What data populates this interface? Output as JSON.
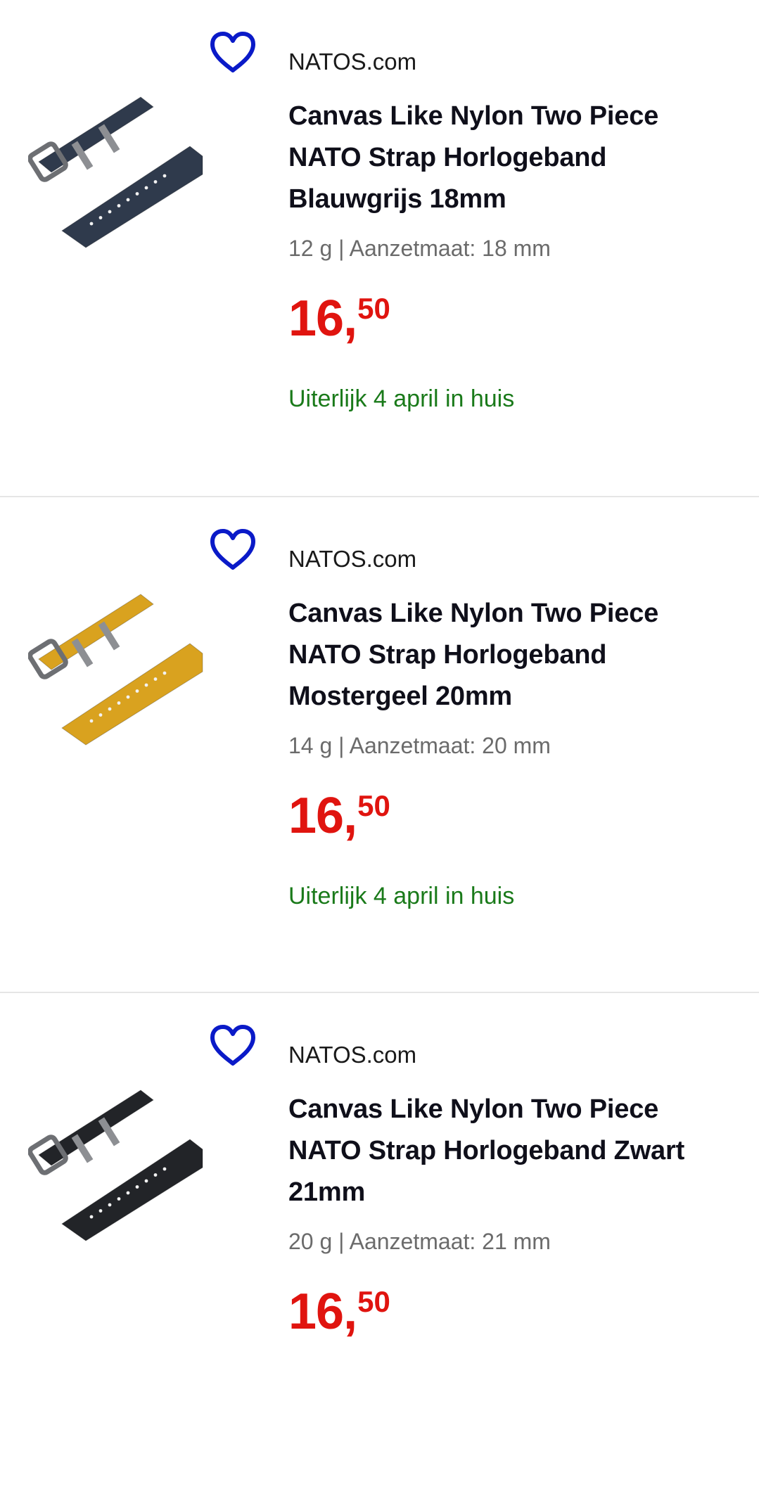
{
  "products": [
    {
      "seller": "NATOS.com",
      "title": "Canvas Like Nylon Two Piece NATO Strap Horlogeband Blauwgrijs 18mm",
      "specs": "12 g | Aanzetmaat: 18 mm",
      "price": {
        "whole": "16",
        "comma": ",",
        "cents": "50"
      },
      "delivery": "Uiterlijk 4 april in huis",
      "image_icon": "watch-strap-image",
      "strap_color": "#2f3a4c"
    },
    {
      "seller": "NATOS.com",
      "title": "Canvas Like Nylon Two Piece NATO Strap Horlogeband Mostergeel 20mm",
      "specs": "14 g | Aanzetmaat: 20 mm",
      "price": {
        "whole": "16",
        "comma": ",",
        "cents": "50"
      },
      "delivery": "Uiterlijk 4 april in huis",
      "image_icon": "watch-strap-image",
      "strap_color": "#d9a21f"
    },
    {
      "seller": "NATOS.com",
      "title": "Canvas Like Nylon Two Piece NATO Strap Horlogeband Zwart 21mm",
      "specs": "20 g | Aanzetmaat: 21 mm",
      "price": {
        "whole": "16",
        "comma": ",",
        "cents": "50"
      },
      "delivery": "",
      "image_icon": "watch-strap-image",
      "strap_color": "#222428"
    }
  ],
  "colors": {
    "favorite_icon": "#0a1ac8",
    "price": "#e0140f",
    "delivery": "#1a7a1a",
    "seller": "#1a1a1a",
    "specs": "#6b6b6b",
    "divider": "#e6e6e6"
  }
}
